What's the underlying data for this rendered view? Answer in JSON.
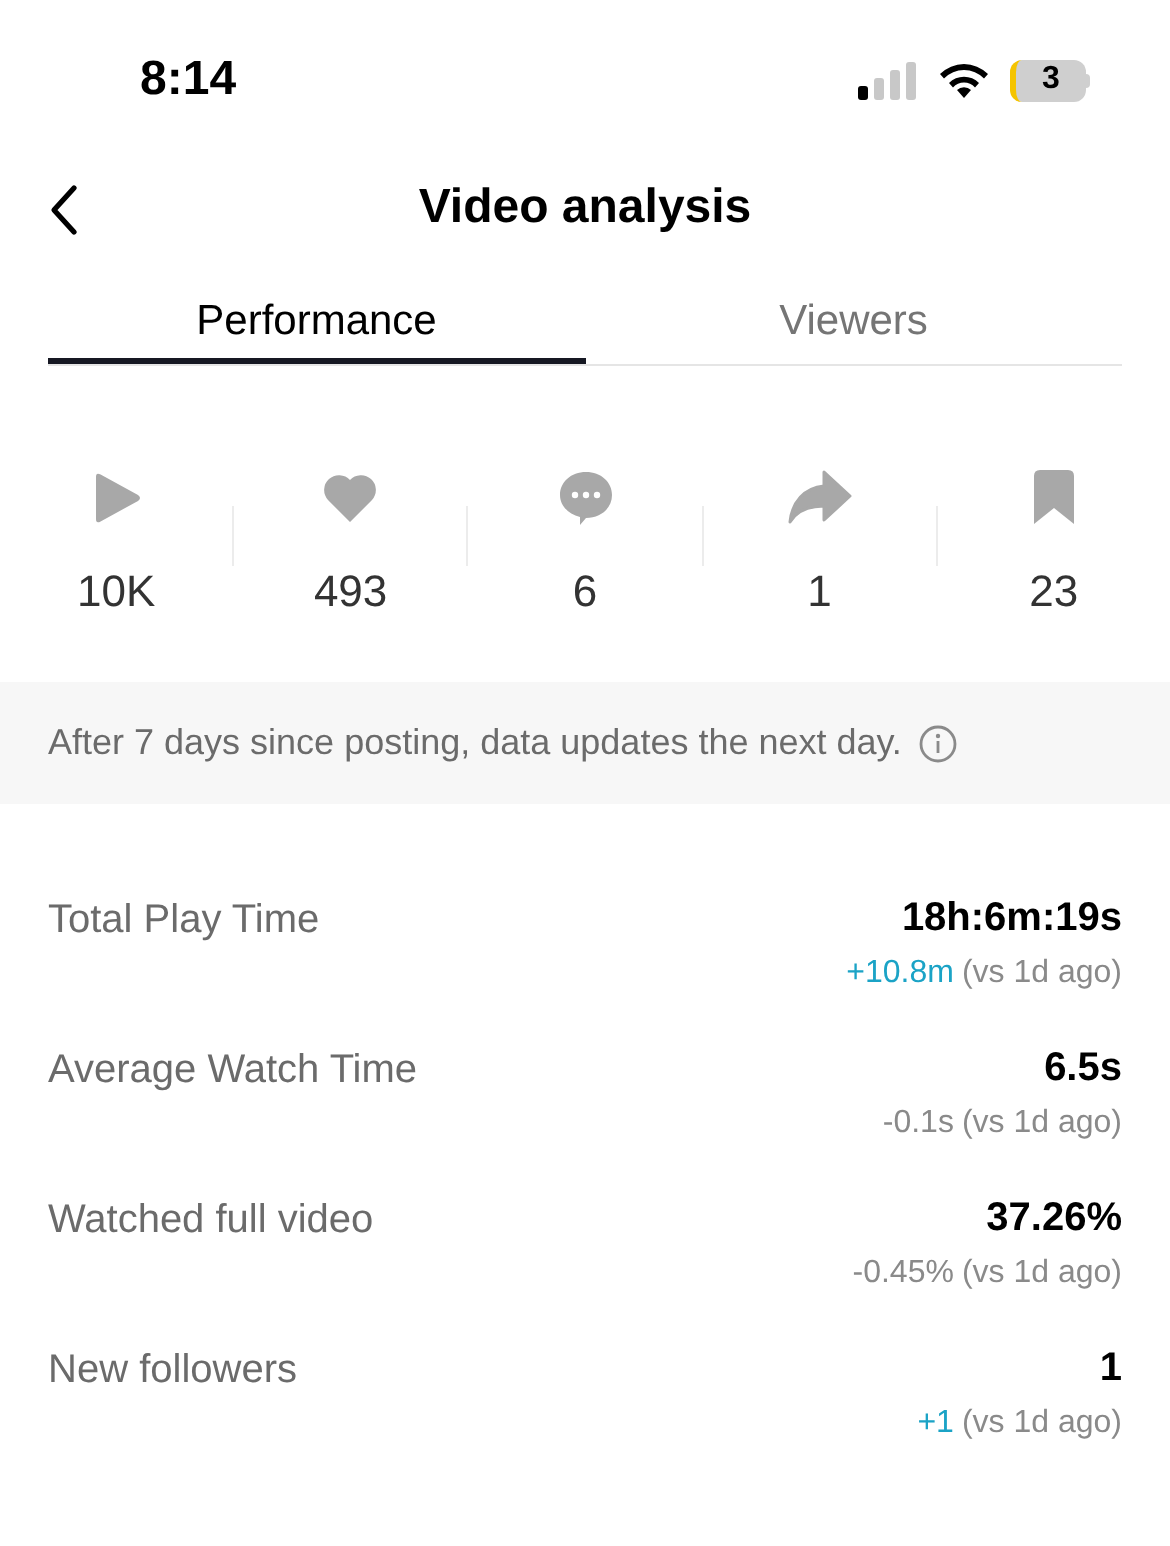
{
  "status_bar": {
    "time": "8:14",
    "battery": "3"
  },
  "header": {
    "title": "Video analysis"
  },
  "tabs": [
    {
      "label": "Performance",
      "selected": true
    },
    {
      "label": "Viewers",
      "selected": false
    }
  ],
  "stats": [
    {
      "kind": "play",
      "value": "10K"
    },
    {
      "kind": "like",
      "value": "493"
    },
    {
      "kind": "comment",
      "value": "6"
    },
    {
      "kind": "share",
      "value": "1"
    },
    {
      "kind": "save",
      "value": "23"
    }
  ],
  "notice": "After 7 days since posting, data updates the next day.",
  "metrics": [
    {
      "label": "Total Play Time",
      "value": "18h:6m:19s",
      "change": "+10.8m",
      "color": "#1ba3c6",
      "comparison": "(vs 1d ago)"
    },
    {
      "label": "Average Watch Time",
      "value": "6.5s",
      "change": "-0.1s",
      "color": "#8a8a8a",
      "comparison": "(vs 1d ago)"
    },
    {
      "label": "Watched full video",
      "value": "37.26%",
      "change": "-0.45%",
      "color": "#8a8a8a",
      "comparison": "(vs 1d ago)"
    },
    {
      "label": "New followers",
      "value": "1",
      "change": "+1",
      "color": "#1ba3c6",
      "comparison": "(vs 1d ago)"
    }
  ]
}
